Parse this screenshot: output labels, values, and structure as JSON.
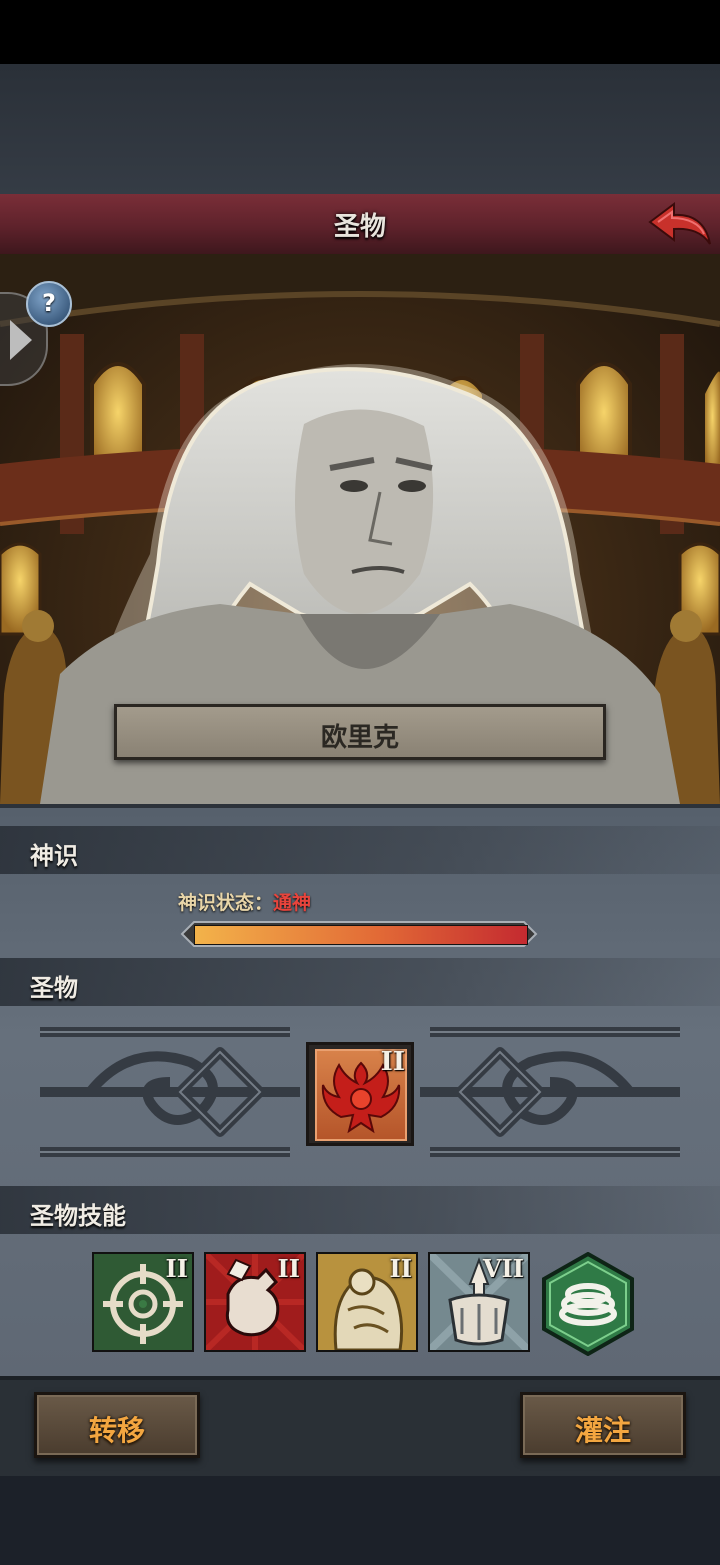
{
  "header": {
    "title": "圣物",
    "back_icon": "back-arrow-icon",
    "accent": "#c8312b"
  },
  "hero": {
    "name": "欧里克",
    "help_glyph": "?"
  },
  "divine": {
    "section_label": "神识",
    "status_label": "神识状态：",
    "status_value": "通神",
    "status_color": "#e8443c",
    "progress": 1.0
  },
  "relic": {
    "section_label": "圣物",
    "slot": {
      "icon": "phoenix-crest-icon",
      "level": "II"
    }
  },
  "skills": {
    "section_label": "圣物技能",
    "items": [
      {
        "icon": "crosshair-target-icon",
        "level": "II"
      },
      {
        "icon": "fist-strike-icon",
        "level": "II"
      },
      {
        "icon": "armored-giant-icon",
        "level": "II"
      },
      {
        "icon": "spike-shield-icon",
        "level": "VII"
      },
      {
        "icon": "spiral-coil-icon",
        "level": ""
      }
    ]
  },
  "actions": {
    "transfer_label": "转移",
    "infuse_label": "灌注"
  }
}
